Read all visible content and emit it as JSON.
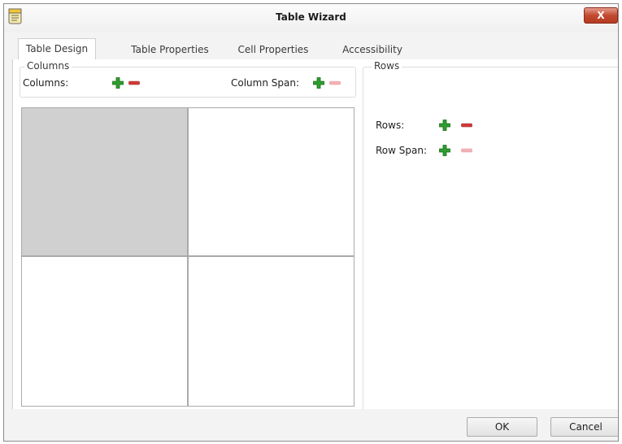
{
  "window": {
    "title": "Table Wizard",
    "close_label": "X"
  },
  "tabs": [
    {
      "label": "Table Design",
      "active": true
    },
    {
      "label": "Table Properties",
      "active": false
    },
    {
      "label": "Cell Properties",
      "active": false
    },
    {
      "label": "Accessibility",
      "active": false
    }
  ],
  "columns_group": {
    "legend": "Columns",
    "columns_label": "Columns:",
    "column_span_label": "Column Span:"
  },
  "rows_group": {
    "legend": "Rows",
    "rows_label": "Rows:",
    "row_span_label": "Row Span:"
  },
  "grid": {
    "rows": 2,
    "columns": 2,
    "selected_cell": "row 1, column 1"
  },
  "icons": {
    "add": "plus-icon",
    "remove": "minus-icon",
    "app": "document-icon"
  },
  "colors": {
    "add_green": "#2e9e2e",
    "remove_red": "#d23a3a",
    "remove_disabled": "#f2b3b6",
    "selected_cell": "#d0d0d0"
  },
  "buttons": {
    "ok": "OK",
    "cancel": "Cancel"
  }
}
